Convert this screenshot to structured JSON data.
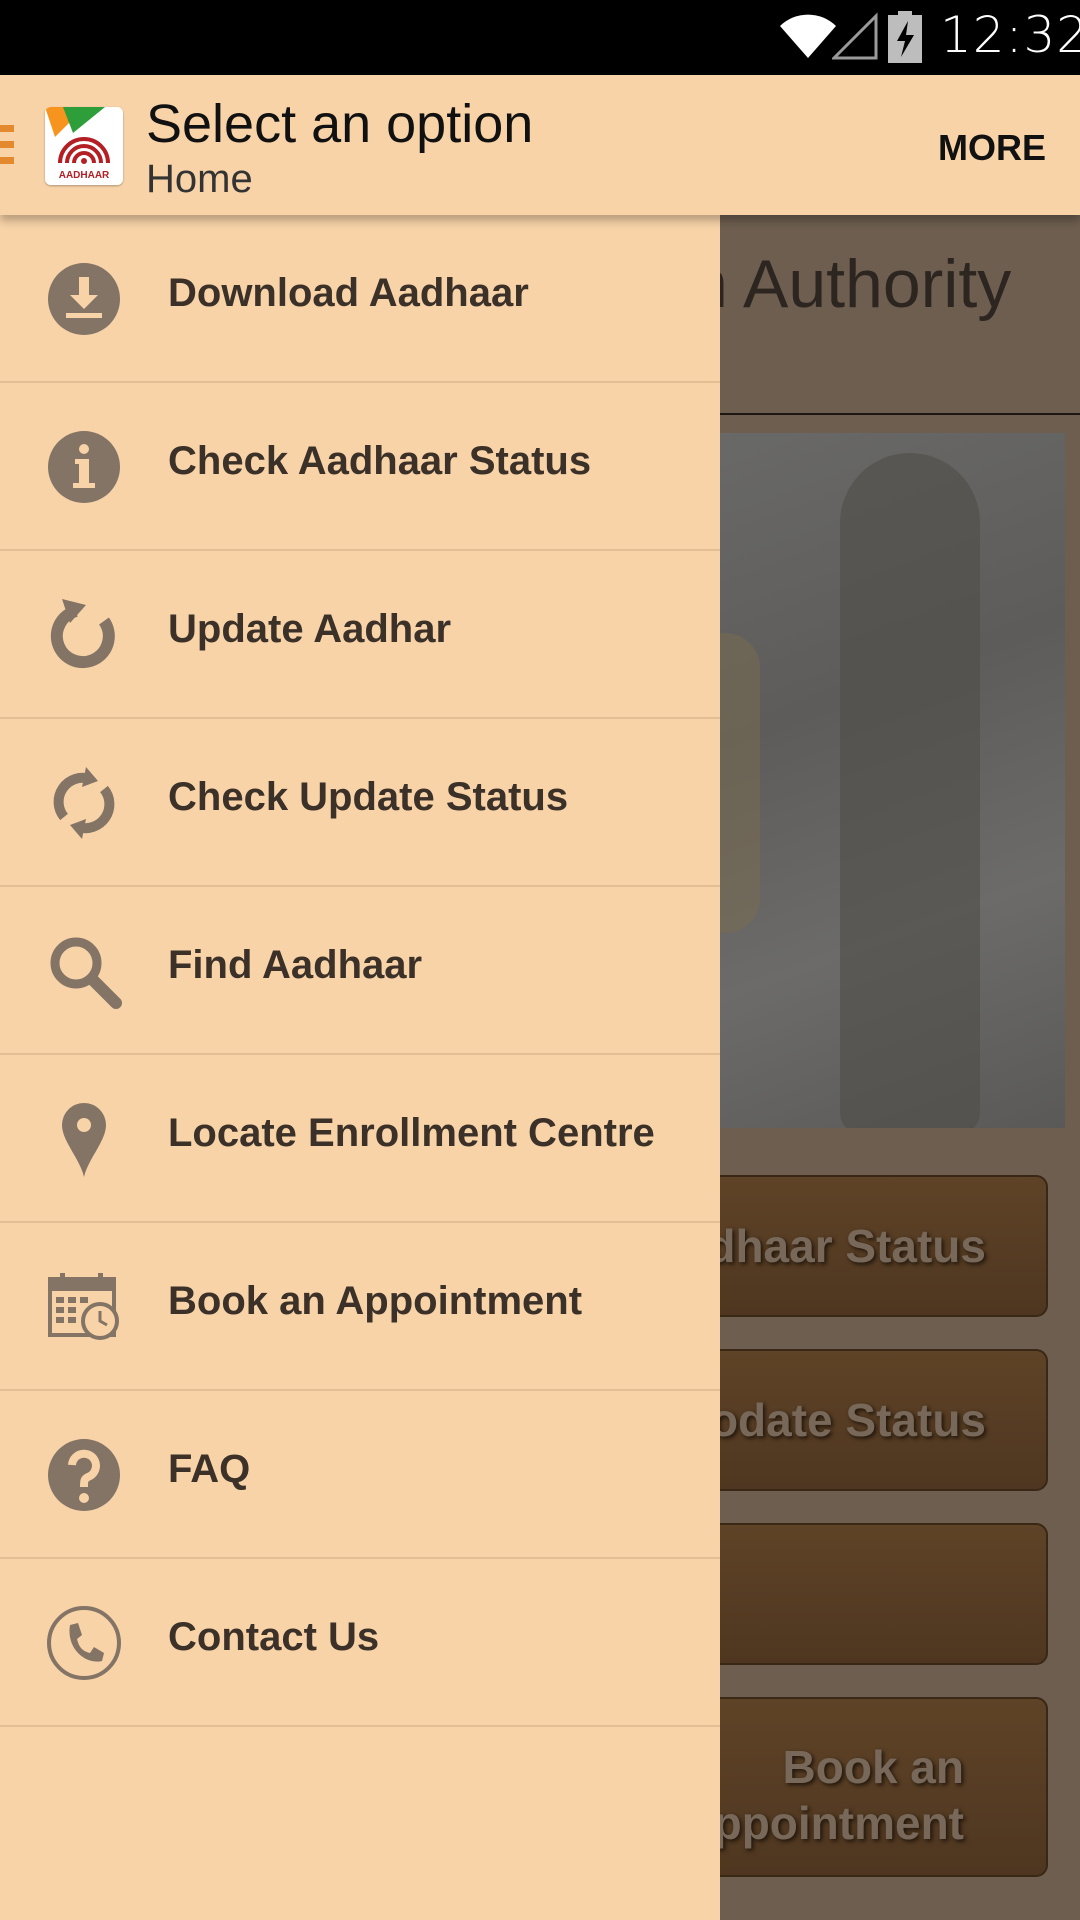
{
  "status_bar": {
    "time": "12:32",
    "icons": [
      "wifi-icon",
      "signal-icon",
      "battery-charging-icon"
    ]
  },
  "action_bar": {
    "title": "Select an option",
    "subtitle": "Home",
    "more_label": "MORE",
    "logo_text": "AADHAAR"
  },
  "home": {
    "title_fragment": "n Authority",
    "buttons": [
      "dhaar Status",
      "odate Status",
      "",
      "Book an\nppointment"
    ]
  },
  "drawer": {
    "items": [
      {
        "label": "Download Aadhaar",
        "icon": "download-icon"
      },
      {
        "label": "Check Aadhaar Status",
        "icon": "info-icon"
      },
      {
        "label": "Update Aadhar",
        "icon": "refresh-icon"
      },
      {
        "label": "Check Update Status",
        "icon": "sync-icon"
      },
      {
        "label": "Find Aadhaar",
        "icon": "search-icon"
      },
      {
        "label": "Locate Enrollment Centre",
        "icon": "location-pin-icon"
      },
      {
        "label": "Book an Appointment",
        "icon": "calendar-clock-icon"
      },
      {
        "label": "FAQ",
        "icon": "question-icon"
      },
      {
        "label": "Contact Us",
        "icon": "phone-icon"
      }
    ]
  },
  "colors": {
    "drawer_bg": "#f8d3a8",
    "icon": "#837466",
    "text": "#3b3129",
    "accent": "#e5892f"
  }
}
